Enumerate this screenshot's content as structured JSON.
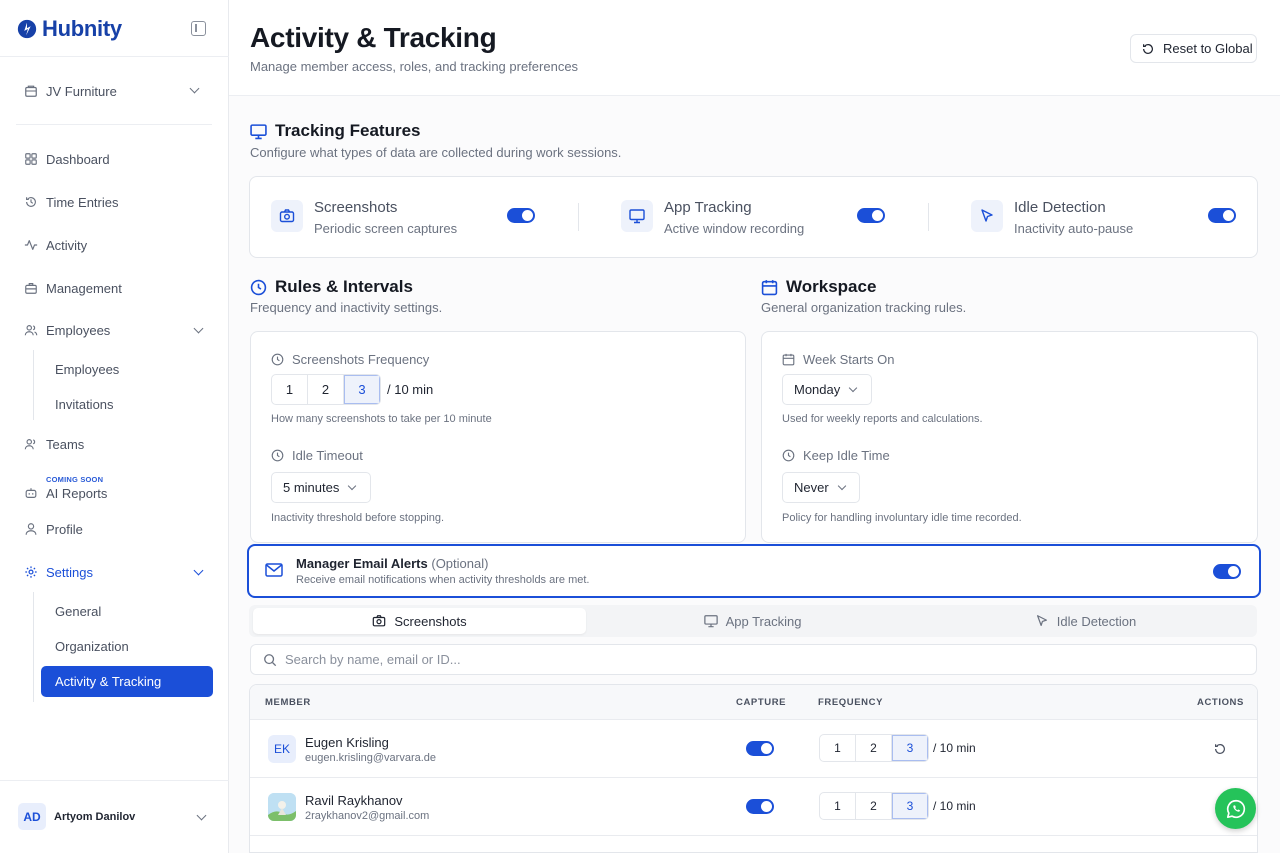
{
  "app": {
    "name": "Hubnity"
  },
  "sidebar": {
    "org": "JV Furniture",
    "items": [
      {
        "label": "Dashboard"
      },
      {
        "label": "Time Entries"
      },
      {
        "label": "Activity"
      },
      {
        "label": "Management"
      },
      {
        "label": "Employees"
      },
      {
        "label": "Teams"
      },
      {
        "label": "AI Reports"
      },
      {
        "label": "Profile"
      },
      {
        "label": "Settings"
      }
    ],
    "employees_sub": [
      "Employees",
      "Invitations"
    ],
    "settings_sub": [
      "General",
      "Organization",
      "Activity & Tracking"
    ],
    "coming_soon": "COMING SOON",
    "user": {
      "initials": "AD",
      "name": "Artyom Danilov"
    }
  },
  "header": {
    "title": "Activity & Tracking",
    "subtitle": "Manage member access, roles, and tracking preferences",
    "reset_label": "Reset to Global"
  },
  "tracking": {
    "title": "Tracking Features",
    "subtitle": "Configure what types of data are collected during work sessions.",
    "features": [
      {
        "title": "Screenshots",
        "desc": "Periodic screen captures",
        "enabled": true
      },
      {
        "title": "App Tracking",
        "desc": "Active window recording",
        "enabled": true
      },
      {
        "title": "Idle Detection",
        "desc": "Inactivity auto-pause",
        "enabled": true
      }
    ]
  },
  "rules": {
    "title": "Rules & Intervals",
    "subtitle": "Frequency and inactivity settings.",
    "freq_label": "Screenshots Frequency",
    "freq_options": [
      "1",
      "2",
      "3"
    ],
    "freq_selected": "3",
    "freq_per": "/  10 min",
    "freq_hint": "How many screenshots to take per 10 minute",
    "idle_label": "Idle Timeout",
    "idle_value": "5 minutes",
    "idle_hint": "Inactivity threshold before stopping."
  },
  "workspace": {
    "title": "Workspace",
    "subtitle": "General organization tracking rules.",
    "week_label": "Week Starts On",
    "week_value": "Monday",
    "week_hint": "Used for weekly reports and calculations.",
    "keep_label": "Keep Idle Time",
    "keep_value": "Never",
    "keep_hint": "Policy for handling involuntary idle time recorded."
  },
  "alerts": {
    "title": "Manager Email Alerts",
    "optional": "(Optional)",
    "desc": "Receive email notifications when activity thresholds are met.",
    "enabled": true
  },
  "tabs": [
    {
      "label": "Screenshots",
      "active": true
    },
    {
      "label": "App Tracking",
      "active": false
    },
    {
      "label": "Idle Detection",
      "active": false
    }
  ],
  "search": {
    "placeholder": "Search by name, email or ID..."
  },
  "table": {
    "headers": {
      "member": "MEMBER",
      "capture": "CAPTURE",
      "frequency": "FREQUENCY",
      "actions": "ACTIONS"
    },
    "rows": [
      {
        "initials": "EK",
        "name": "Eugen Krisling",
        "email": "eugen.krisling@varvara.de",
        "capture": true,
        "freq": [
          "1",
          "2",
          "3"
        ],
        "selected": "3",
        "per": "/  10 min"
      },
      {
        "initials": "",
        "name": "Ravil Raykhanov",
        "email": "2raykhanov2@gmail.com",
        "capture": true,
        "freq": [
          "1",
          "2",
          "3"
        ],
        "selected": "3",
        "per": "/  10 min"
      }
    ]
  },
  "colors": {
    "accent": "#1b4fd8",
    "brand": "#1741a8",
    "whatsapp": "#25c35a"
  }
}
